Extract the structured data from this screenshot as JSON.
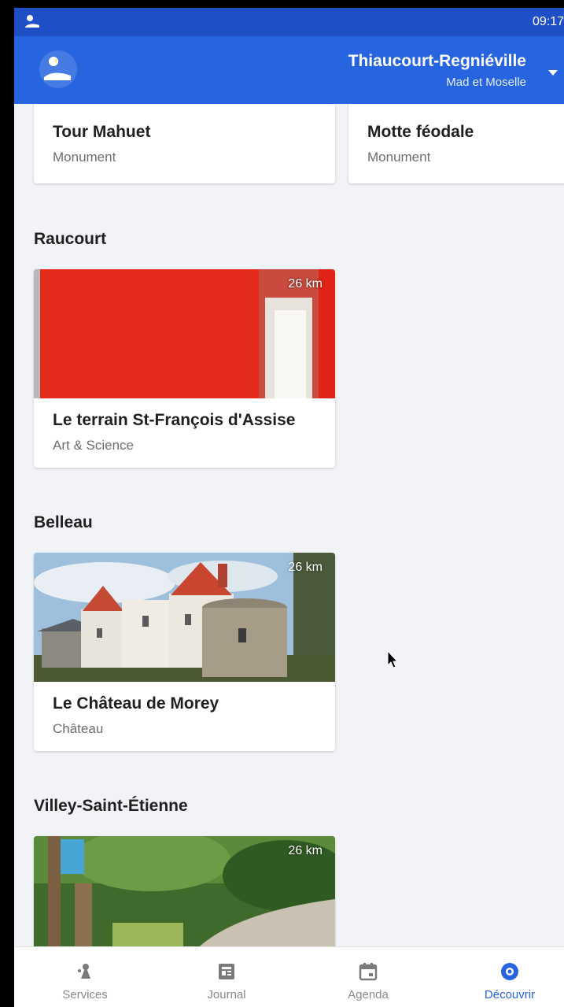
{
  "status_bar": {
    "time": "09:17"
  },
  "app_bar": {
    "title": "Thiaucourt-Regniéville",
    "subtitle": "Mad et Moselle"
  },
  "top_cards": [
    {
      "title": "Tour Mahuet",
      "category": "Monument"
    },
    {
      "title": "Motte féodale",
      "category": "Monument"
    }
  ],
  "sections": [
    {
      "name": "Raucourt",
      "card": {
        "title": "Le terrain St-François d'Assise",
        "category": "Art & Science",
        "distance": "26 km"
      }
    },
    {
      "name": "Belleau",
      "card": {
        "title": "Le Château de Morey",
        "category": "Château",
        "distance": "26 km"
      }
    },
    {
      "name": "Villey-Saint-Étienne",
      "card": {
        "title": "",
        "category": "",
        "distance": "26 km"
      }
    }
  ],
  "bottom_nav": [
    {
      "label": "Services",
      "icon": "services-icon"
    },
    {
      "label": "Journal",
      "icon": "journal-icon"
    },
    {
      "label": "Agenda",
      "icon": "calendar-icon"
    },
    {
      "label": "Découvrir",
      "icon": "compass-icon",
      "active": true
    }
  ],
  "colors": {
    "primary": "#2664e0",
    "status_bar": "#1f4fc6",
    "background": "#f2f3f6"
  }
}
